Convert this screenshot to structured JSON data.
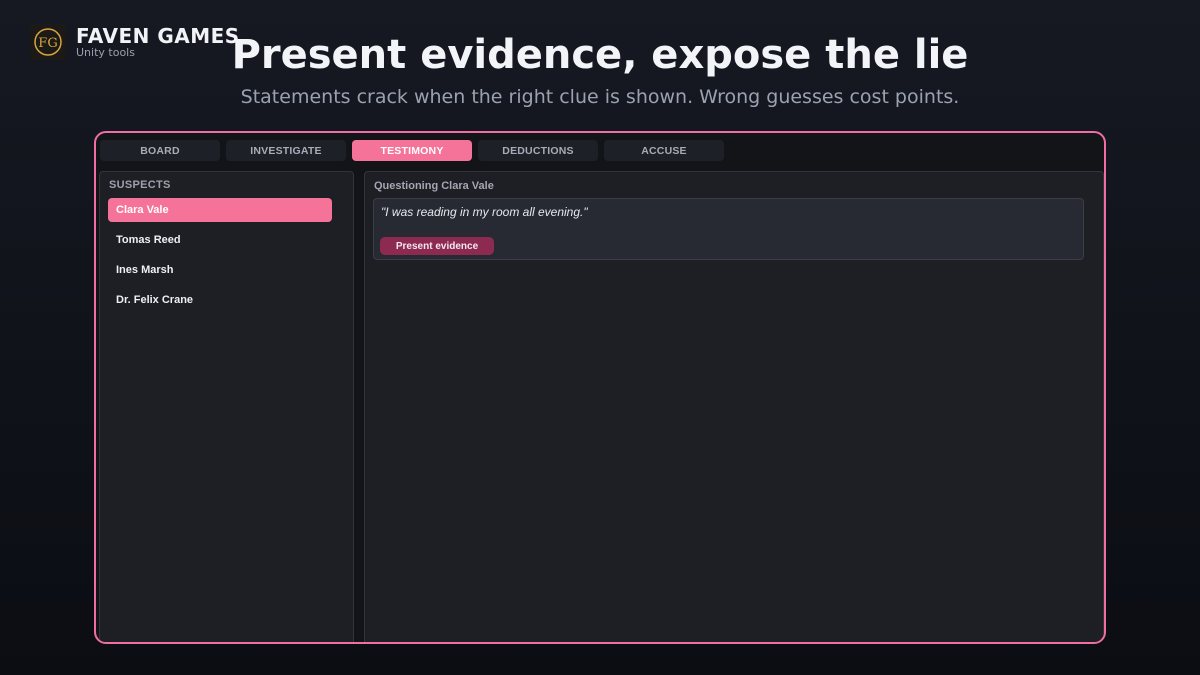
{
  "brand": {
    "name": "FAVEN GAMES",
    "subtitle": "Unity tools",
    "logo_letters": "FG",
    "logo_color": "#d9a441"
  },
  "hero": {
    "title": "Present evidence, expose the lie",
    "subtitle": "Statements crack when the right clue is shown. Wrong guesses cost points."
  },
  "app": {
    "accent_color": "#f57399",
    "tabs": [
      {
        "label": "BOARD",
        "active": false
      },
      {
        "label": "INVESTIGATE",
        "active": false
      },
      {
        "label": "TESTIMONY",
        "active": true
      },
      {
        "label": "DEDUCTIONS",
        "active": false
      },
      {
        "label": "ACCUSE",
        "active": false
      }
    ],
    "suspects": {
      "title": "SUSPECTS",
      "items": [
        {
          "name": "Clara Vale",
          "selected": true
        },
        {
          "name": "Tomas Reed",
          "selected": false
        },
        {
          "name": "Ines Marsh",
          "selected": false
        },
        {
          "name": "Dr. Felix Crane",
          "selected": false
        }
      ]
    },
    "testimony": {
      "title": "Questioning Clara Vale",
      "statement": "\"I was reading in my room all evening.\"",
      "present_button": "Present evidence"
    }
  }
}
